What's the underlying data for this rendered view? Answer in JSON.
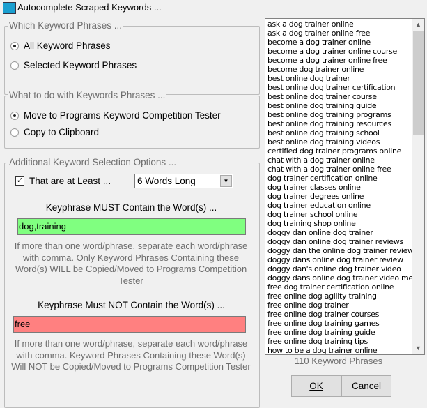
{
  "window": {
    "title": "Autocomplete Scraped Keywords ..."
  },
  "which": {
    "legend": "Which Keyword Phrases ...",
    "options": [
      {
        "label": "All Keyword Phrases",
        "selected": true
      },
      {
        "label": "Selected Keyword Phrases",
        "selected": false
      }
    ]
  },
  "what": {
    "legend": "What to do with Keywords Phrases ...",
    "options": [
      {
        "label": "Move to Programs Keyword Competition Tester",
        "selected": true
      },
      {
        "label": "Copy to Clipboard",
        "selected": false
      }
    ]
  },
  "additional": {
    "legend": "Additional Keyword Selection Options ...",
    "at_least_label": "That are at Least ...",
    "at_least_checked": true,
    "words_select": "6 Words Long",
    "must_label": "Keyphrase MUST Contain the Word(s) ...",
    "must_value": "dog,training",
    "must_color": "#80ff80",
    "must_help": "If more than one word/phrase, separate each word/phrase with comma. Only Keyword Phrases Containing these Word(s) WILL be Copied/Moved to Programs Competition Tester",
    "not_label": "Keyphrase Must NOT Contain the Word(s) ...",
    "not_value": "free",
    "not_color": "#ff8080",
    "not_help": "If more than one word/phrase, separate each word/phrase with comma. Keyword Phrases Containing these Word(s) Will NOT be Copied/Moved to Programs Competition Tester"
  },
  "keywords": [
    "ask a dog trainer online",
    "ask a dog trainer online free",
    "become a dog trainer online",
    "become a dog trainer online course",
    "become a dog trainer online free",
    "become dog trainer online",
    "best online dog trainer",
    "best online dog trainer certification",
    "best online dog trainer course",
    "best online dog training guide",
    "best online dog training programs",
    "best online dog training resources",
    "best online dog training school",
    "best online dog training videos",
    "certified dog trainer programs online",
    "chat with a dog trainer online",
    "chat with a dog trainer online free",
    "dog trainer certification online",
    "dog trainer classes online",
    "dog trainer degrees online",
    "dog trainer education online",
    "dog trainer school online",
    "dog training shop online",
    "doggy dan online dog trainer",
    "doggy dan online dog trainer reviews",
    "doggy dan the online dog trainer reviews",
    "doggy dans online dog trainer review",
    "doggy dan's online dog trainer video",
    "doggy dans online dog trainer video member",
    "free dog trainer certification online",
    "free online dog agility training",
    "free online dog trainer",
    "free online dog trainer courses",
    "free online dog training games",
    "free online dog training guide",
    "free online dog training tips",
    "how to be a dog trainer online"
  ],
  "count_label": "110 Keyword Phrases",
  "buttons": {
    "ok": "OK",
    "cancel": "Cancel"
  }
}
